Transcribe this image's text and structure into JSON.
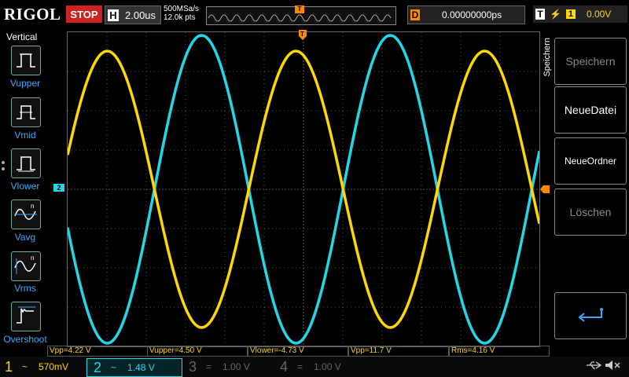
{
  "topbar": {
    "brand": "RIGOL",
    "run_state": "STOP",
    "horizontal_key": "H",
    "timebase": "2.00us",
    "sample_rate": "500MSa/s",
    "memory_depth": "12.0k pts",
    "trigger_pos_marker": "T",
    "delay_key": "D",
    "delay_value": "0.00000000ps",
    "trigger_key": "T",
    "trigger_source": "1",
    "trigger_level": "0.00V"
  },
  "left_menu": {
    "title": "Vertical",
    "items": [
      {
        "label": "Vupper",
        "icon": "vupper-icon"
      },
      {
        "label": "Vmid",
        "icon": "vmid-icon"
      },
      {
        "label": "Vlower",
        "icon": "vlower-icon"
      },
      {
        "label": "Vavg",
        "icon": "vavg-icon"
      },
      {
        "label": "Vrms",
        "icon": "vrms-icon"
      },
      {
        "label": "Overshoot",
        "icon": "overshoot-icon"
      }
    ]
  },
  "right_menu": {
    "title": "Speichern",
    "buttons": [
      {
        "label": "Speichern",
        "enabled": false
      },
      {
        "label": "NeueDatei",
        "enabled": true
      },
      {
        "label": "NeueOrdner",
        "enabled": true
      },
      {
        "label": "Löschen",
        "enabled": false
      }
    ],
    "return_icon": "return-arrow-icon"
  },
  "markers": {
    "ch2_ground": "2",
    "trigger_arrow": "T"
  },
  "measurements": [
    {
      "text": "Vpp=4.22 V"
    },
    {
      "text": "Vupper=4.50 V"
    },
    {
      "text": "Vlower=-4.73 V"
    },
    {
      "text": "Vpp=11.7 V"
    },
    {
      "text": "Rms=4.16 V"
    }
  ],
  "channels": [
    {
      "num": "1",
      "coupling": "~",
      "scale": "570mV",
      "color": "#ffd800",
      "active": true
    },
    {
      "num": "2",
      "coupling": "~",
      "scale": "1.48 V",
      "color": "#22d8e8",
      "active": true
    },
    {
      "num": "3",
      "coupling": "=",
      "scale": "1.00 V",
      "color": "#666666",
      "active": false
    },
    {
      "num": "4",
      "coupling": "=",
      "scale": "1.00 V",
      "color": "#666666",
      "active": false
    }
  ],
  "colors": {
    "ch1": "#ffd800",
    "ch2": "#22d8e8",
    "trigger": "#ff8800",
    "accent": "#3aa8ff",
    "stop": "#cc2222"
  },
  "waveforms": {
    "ch1": {
      "shape": "sine",
      "cycles_on_screen": 2.5,
      "amplitude_fraction": 0.88
    },
    "ch2": {
      "shape": "sine",
      "cycles_on_screen": 2.5,
      "amplitude_fraction": 0.98,
      "phase_offset_deg": 180
    }
  }
}
